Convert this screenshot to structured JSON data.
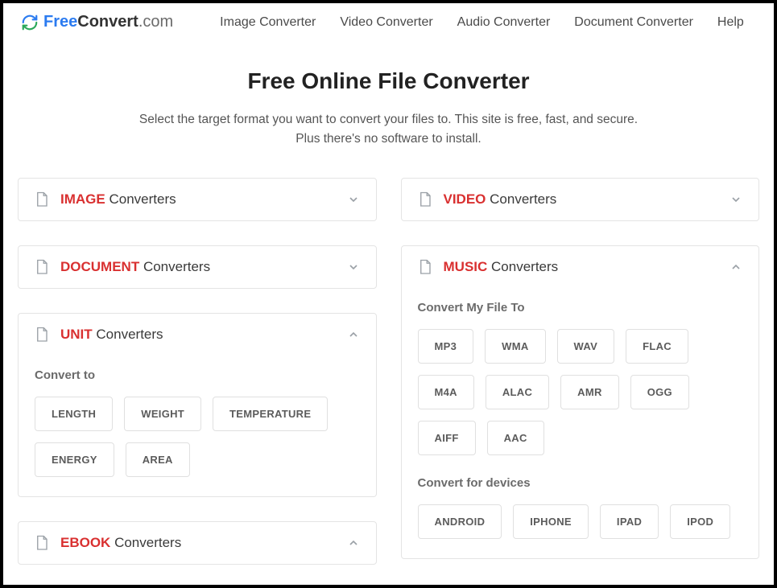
{
  "logo": {
    "free": "Free",
    "convert": "Convert",
    "com": ".com"
  },
  "nav": {
    "image": "Image Converter",
    "video": "Video Converter",
    "audio": "Audio Converter",
    "document": "Document Converter",
    "help": "Help"
  },
  "hero": {
    "title": "Free Online File Converter",
    "line1": "Select the target format you want to convert your files to. This site is free, fast, and secure.",
    "line2": "Plus there's no software to install."
  },
  "suffix": "Converters",
  "panels": {
    "image": "IMAGE",
    "video": "VIDEO",
    "document": "DOCUMENT",
    "music": "MUSIC",
    "unit": "UNIT",
    "ebook": "EBOOK"
  },
  "unit": {
    "label": "Convert to",
    "items": {
      "length": "LENGTH",
      "weight": "WEIGHT",
      "temperature": "TEMPERATURE",
      "energy": "ENERGY",
      "area": "AREA"
    }
  },
  "music": {
    "label1": "Convert My File To",
    "formats": {
      "mp3": "MP3",
      "wma": "WMA",
      "wav": "WAV",
      "flac": "FLAC",
      "m4a": "M4A",
      "alac": "ALAC",
      "amr": "AMR",
      "ogg": "OGG",
      "aiff": "AIFF",
      "aac": "AAC"
    },
    "label2": "Convert for devices",
    "devices": {
      "android": "ANDROID",
      "iphone": "IPHONE",
      "ipad": "IPAD",
      "ipod": "IPOD"
    }
  }
}
